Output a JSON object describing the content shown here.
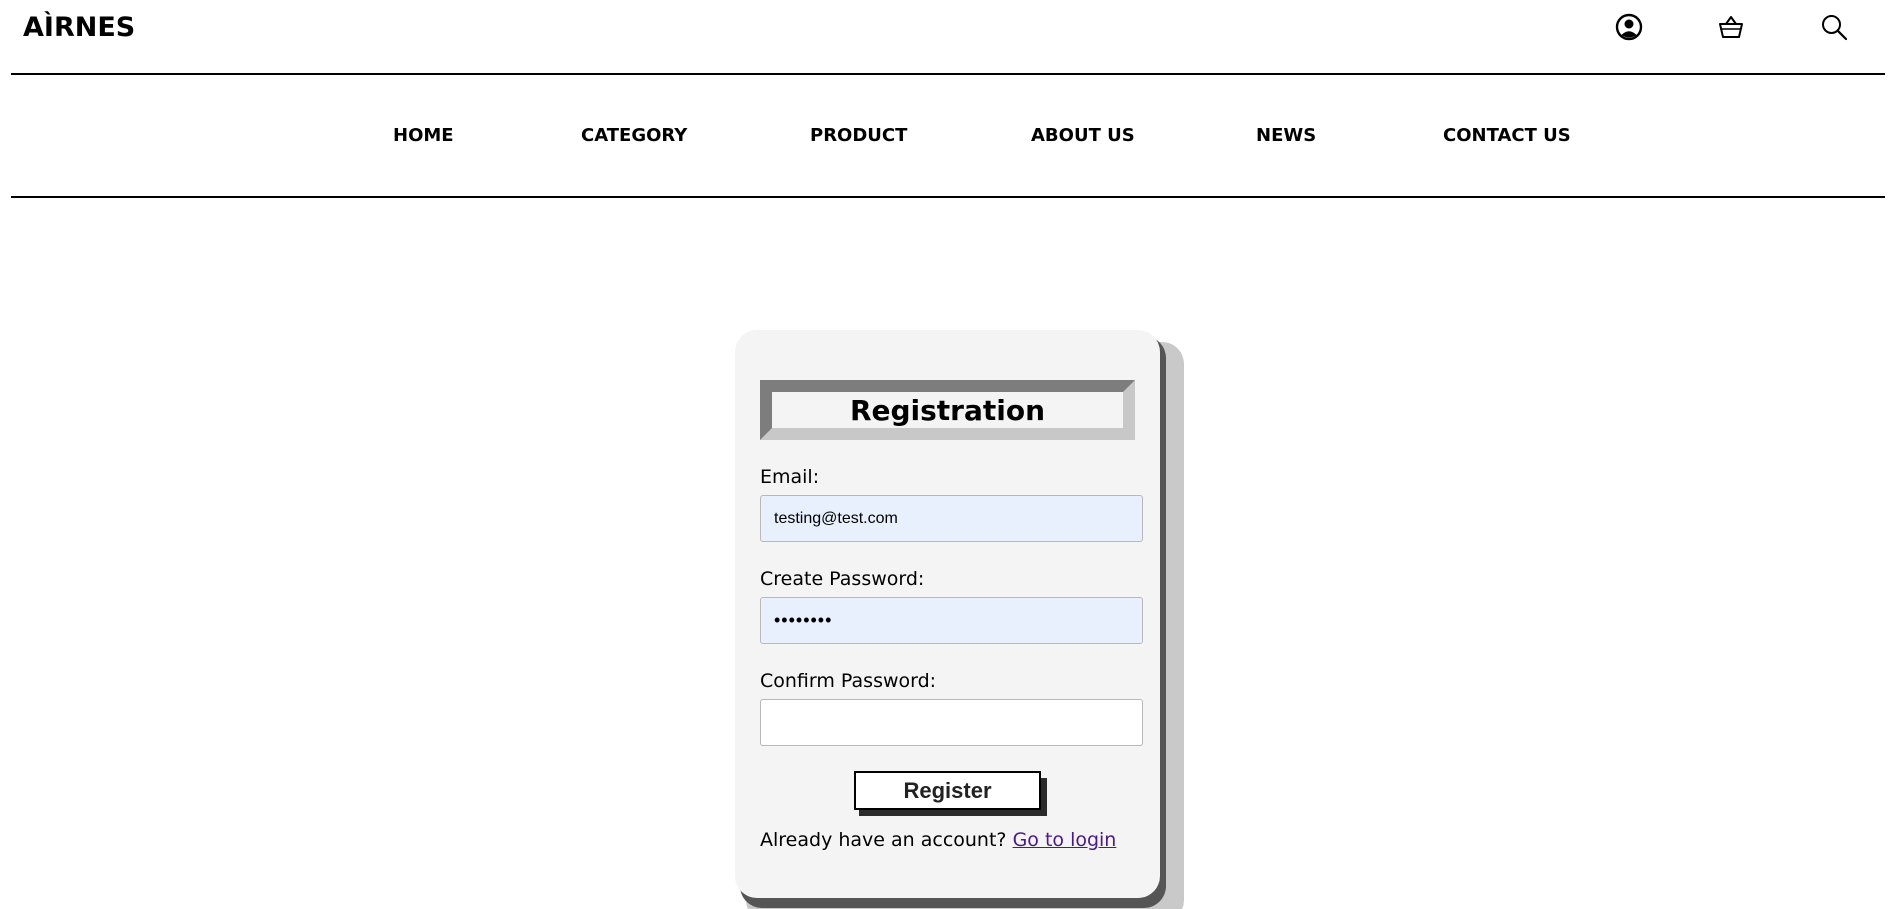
{
  "header": {
    "logo": "AÌRNES",
    "icons": [
      "user-account-icon",
      "shopping-basket-icon",
      "search-icon"
    ]
  },
  "nav": {
    "items": [
      {
        "label": "HOME"
      },
      {
        "label": "CATEGORY"
      },
      {
        "label": "PRODUCT"
      },
      {
        "label": "ABOUT US"
      },
      {
        "label": "NEWS"
      },
      {
        "label": "CONTACT US"
      }
    ]
  },
  "form": {
    "title": "Registration",
    "email_label": "Email:",
    "email_value": "testing@test.com",
    "create_password_label": "Create Password:",
    "create_password_value": "testpass",
    "confirm_password_label": "Confirm Password:",
    "confirm_password_value": "",
    "register_label": "Register",
    "account_prompt": "Already have an account?",
    "login_link": "Go to login"
  },
  "colors": {
    "autofill_background": "#e8f0fe",
    "card_background": "#f4f4f4",
    "link": "#4a1a8c"
  }
}
